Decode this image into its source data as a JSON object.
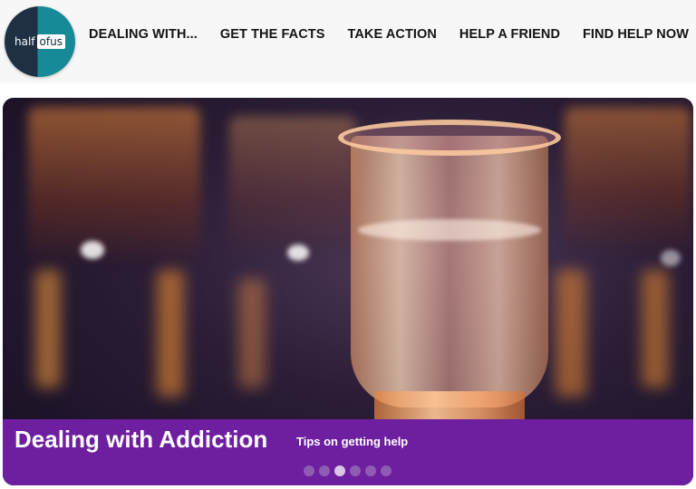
{
  "logo": {
    "part1": "half",
    "part2": "ofus",
    "icon": "half-of-us-logo"
  },
  "nav": {
    "items": [
      {
        "label": "DEALING WITH..."
      },
      {
        "label": "GET THE FACTS"
      },
      {
        "label": "TAKE ACTION"
      },
      {
        "label": "HELP A FRIEND"
      },
      {
        "label": "FIND HELP NOW"
      }
    ]
  },
  "hero": {
    "image": "shot-glass-photo",
    "title": "Dealing with Addiction",
    "subtitle": "Tips on getting help",
    "slides_total": 6,
    "active_slide": 3
  },
  "colors": {
    "caption_bg": "#6e1fa0",
    "logo_dark": "#1f2f44",
    "logo_teal": "#178a97",
    "nav_text": "#141414"
  }
}
